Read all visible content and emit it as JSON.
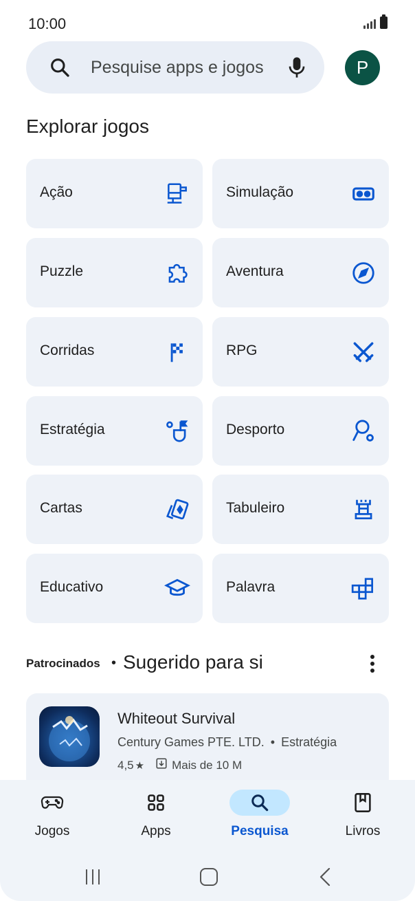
{
  "status_bar": {
    "time": "10:00"
  },
  "search": {
    "placeholder": "Pesquise apps e jogos",
    "avatar_letter": "P"
  },
  "section_title": "Explorar jogos",
  "categories": [
    {
      "label": "Ação",
      "icon": "action-icon"
    },
    {
      "label": "Simulação",
      "icon": "vr-headset-icon"
    },
    {
      "label": "Puzzle",
      "icon": "puzzle-piece-icon"
    },
    {
      "label": "Aventura",
      "icon": "compass-icon"
    },
    {
      "label": "Corridas",
      "icon": "checkered-flag-icon"
    },
    {
      "label": "RPG",
      "icon": "crossed-swords-icon"
    },
    {
      "label": "Estratégia",
      "icon": "strategy-flag-icon"
    },
    {
      "label": "Desporto",
      "icon": "racket-icon"
    },
    {
      "label": "Cartas",
      "icon": "playing-cards-icon"
    },
    {
      "label": "Tabuleiro",
      "icon": "chess-rook-icon"
    },
    {
      "label": "Educativo",
      "icon": "graduation-cap-icon"
    },
    {
      "label": "Palavra",
      "icon": "word-tiles-icon"
    }
  ],
  "suggested": {
    "sponsored_label": "Patrocinados",
    "separator": "•",
    "title": "Sugerido para si",
    "app": {
      "name": "Whiteout Survival",
      "developer": "Century Games PTE. LTD.",
      "dev_separator": "•",
      "genre": "Estratégia",
      "rating": "4,5",
      "rating_star": "★",
      "downloads": "Mais de 10 M"
    }
  },
  "bottom_nav": [
    {
      "label": "Jogos",
      "icon": "gamepad-icon",
      "active": false
    },
    {
      "label": "Apps",
      "icon": "apps-grid-icon",
      "active": false
    },
    {
      "label": "Pesquisa",
      "icon": "search-icon",
      "active": true
    },
    {
      "label": "Livros",
      "icon": "book-icon",
      "active": false
    }
  ],
  "colors": {
    "accent": "#0b57d0",
    "tile_bg": "#eef2f8",
    "avatar": "#0b5345",
    "active_pill": "#c2e7ff"
  }
}
